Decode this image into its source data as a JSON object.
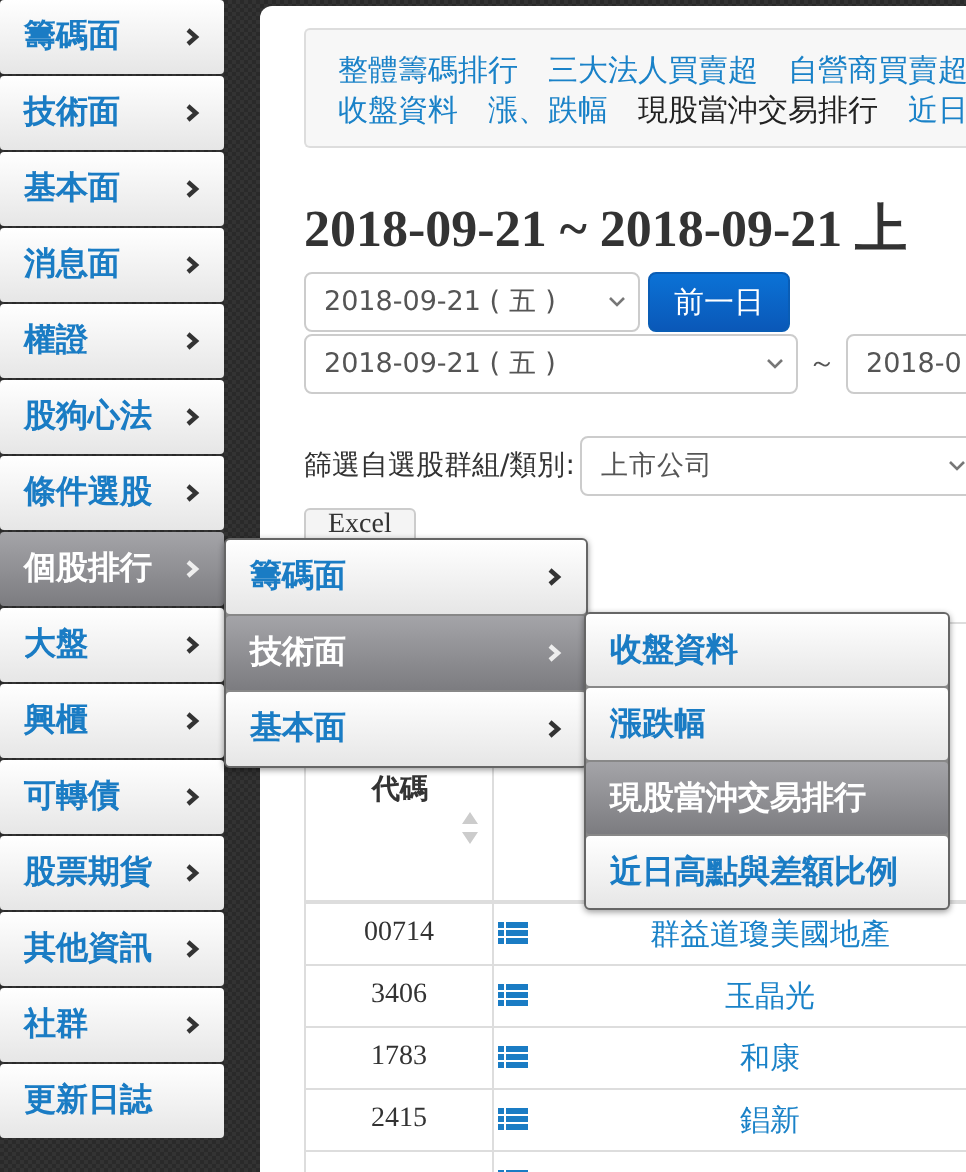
{
  "sidebar": {
    "items": [
      {
        "label": "籌碼面",
        "has_submenu": true,
        "selected": false
      },
      {
        "label": "技術面",
        "has_submenu": true,
        "selected": false
      },
      {
        "label": "基本面",
        "has_submenu": true,
        "selected": false
      },
      {
        "label": "消息面",
        "has_submenu": true,
        "selected": false
      },
      {
        "label": "權證",
        "has_submenu": true,
        "selected": false
      },
      {
        "label": "股狗心法",
        "has_submenu": true,
        "selected": false
      },
      {
        "label": "條件選股",
        "has_submenu": true,
        "selected": false
      },
      {
        "label": "個股排行",
        "has_submenu": true,
        "selected": true
      },
      {
        "label": "大盤",
        "has_submenu": true,
        "selected": false
      },
      {
        "label": "興櫃",
        "has_submenu": true,
        "selected": false
      },
      {
        "label": "可轉債",
        "has_submenu": true,
        "selected": false
      },
      {
        "label": "股票期貨",
        "has_submenu": true,
        "selected": false
      },
      {
        "label": "其他資訊",
        "has_submenu": true,
        "selected": false
      },
      {
        "label": "社群",
        "has_submenu": true,
        "selected": false
      },
      {
        "label": "更新日誌",
        "has_submenu": false,
        "selected": false
      }
    ]
  },
  "submenu": {
    "items": [
      {
        "label": "籌碼面",
        "has_submenu": true,
        "selected": false
      },
      {
        "label": "技術面",
        "has_submenu": true,
        "selected": true
      },
      {
        "label": "基本面",
        "has_submenu": true,
        "selected": false
      }
    ]
  },
  "submenu_2": {
    "items": [
      {
        "label": "收盤資料",
        "selected": false
      },
      {
        "label": "漲跌幅",
        "selected": false
      },
      {
        "label": "現股當沖交易排行",
        "selected": true
      },
      {
        "label": "近日高點與差額比例",
        "selected": false
      }
    ]
  },
  "nav_links": [
    [
      {
        "label": "整體籌碼排行",
        "selected": false
      },
      {
        "label": "三大法人買賣超",
        "selected": false
      },
      {
        "label": "自營商買賣超",
        "selected": false
      }
    ],
    [
      {
        "label": "收盤資料",
        "selected": false
      },
      {
        "label": "漲、跌幅",
        "selected": false
      },
      {
        "label": "現股當沖交易排行",
        "selected": true
      },
      {
        "label": "近日",
        "selected": false
      }
    ]
  ],
  "heading": "2018-09-21 ~ 2018-09-21 上",
  "date_select": {
    "value": "2018-09-21 ( 五 )"
  },
  "prev_day_button": "前一日",
  "range": {
    "start": "2018-09-21 ( 五 )",
    "separator": "～",
    "end": "2018-0"
  },
  "filter": {
    "label": "篩選自選股群組/類別:",
    "value": "上市公司"
  },
  "excel_button": "Excel",
  "table": {
    "columns": [
      "代碼"
    ],
    "rows": [
      {
        "code": "00714",
        "name": "群益道瓊美國地產"
      },
      {
        "code": "3406",
        "name": "玉晶光"
      },
      {
        "code": "1783",
        "name": "和康"
      },
      {
        "code": "2415",
        "name": "錩新"
      }
    ]
  }
}
